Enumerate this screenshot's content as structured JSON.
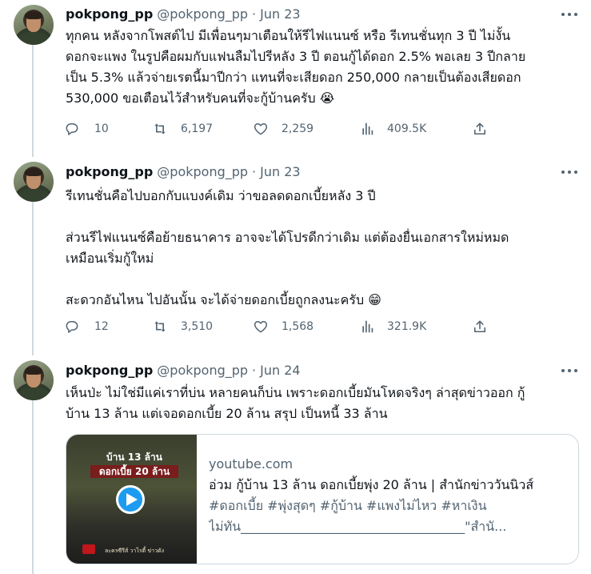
{
  "tweets": [
    {
      "name": "pokpong_pp",
      "handle": "@pokpong_pp",
      "dot": "·",
      "date": "Jun 23",
      "text": "ทุกคน หลังจากโพสต์ไป มีเพื่อนๆมาเตือนให้รีไฟแนนซ์ หรือ รีเทนชั่นทุก 3 ปี ไม่งั้น\nดอกจะแพง ในรูปคือผมกับแฟนลืมไปรีหลัง 3 ปี ตอนกู้ได้ดอก 2.5% พอเลย 3 ปีกลาย\nเป็น 5.3% แล้วจ่ายเรตนี้มาปีกว่า แทนที่จะเสียดอก 250,000 กลายเป็นต้องเสียดอก\n530,000 ขอเตือนไว้สำหรับคนที่จะกู้บ้านครับ 😭",
      "replies": "10",
      "retweets": "6,197",
      "likes": "2,259",
      "views": "409.5K"
    },
    {
      "name": "pokpong_pp",
      "handle": "@pokpong_pp",
      "dot": "·",
      "date": "Jun 23",
      "text": "รีเทนชั่นคือไปบอกกับแบงค์เดิม ว่าขอลดดอกเบี้ยหลัง 3 ปี\n\nส่วนรีไฟแนนซ์คือย้ายธนาคาร อาจจะได้โปรดีกว่าเดิม แต่ต้องยื่นเอกสารใหม่หมด\nเหมือนเริ่มกู้ใหม่\n\nสะดวกอันไหน ไปอันนั้น จะได้จ่ายดอกเบี้ยถูกลงนะครับ 😁",
      "replies": "12",
      "retweets": "3,510",
      "likes": "1,568",
      "views": "321.9K"
    },
    {
      "name": "pokpong_pp",
      "handle": "@pokpong_pp",
      "dot": "·",
      "date": "Jun 24",
      "text": "เห็นป่ะ ไม่ใช่มีแค่เราที่บ่น หลายคนก็บ่น เพราะดอกเบี้ยมันโหดจริงๆ ล่าสุดข่าวออก กู้\nบ้าน 13 ล้าน แต่เจอดอกเบี้ย 20 ล้าน สรุป เป็นหนี้ 33 ล้าน"
    }
  ],
  "card": {
    "domain": "youtube.com",
    "title": "อ่วม กู้บ้าน 13 ล้าน ดอกเบี้ยพุ่ง 20 ล้าน | สำนักข่าววันนิวส์",
    "desc": "#ดอกเบี้ย #พุ่งสุดๆ #กู้บ้าน #แพงไม่ไหว #หาเงิน",
    "desc2": "ไม่ทัน___________________________________\"สำนั...",
    "thumb_line1": "บ้าน 13 ล้าน",
    "thumb_line2": "ดอกเบี้ย 20 ล้าน",
    "thumb_footer": "ละครซีรีส์ วาไรตี้ ข่าวดัง"
  },
  "colors": {
    "text": "#0f1419",
    "secondary": "#536471",
    "border": "#cfd9de",
    "accent": "#1d9bf0"
  }
}
